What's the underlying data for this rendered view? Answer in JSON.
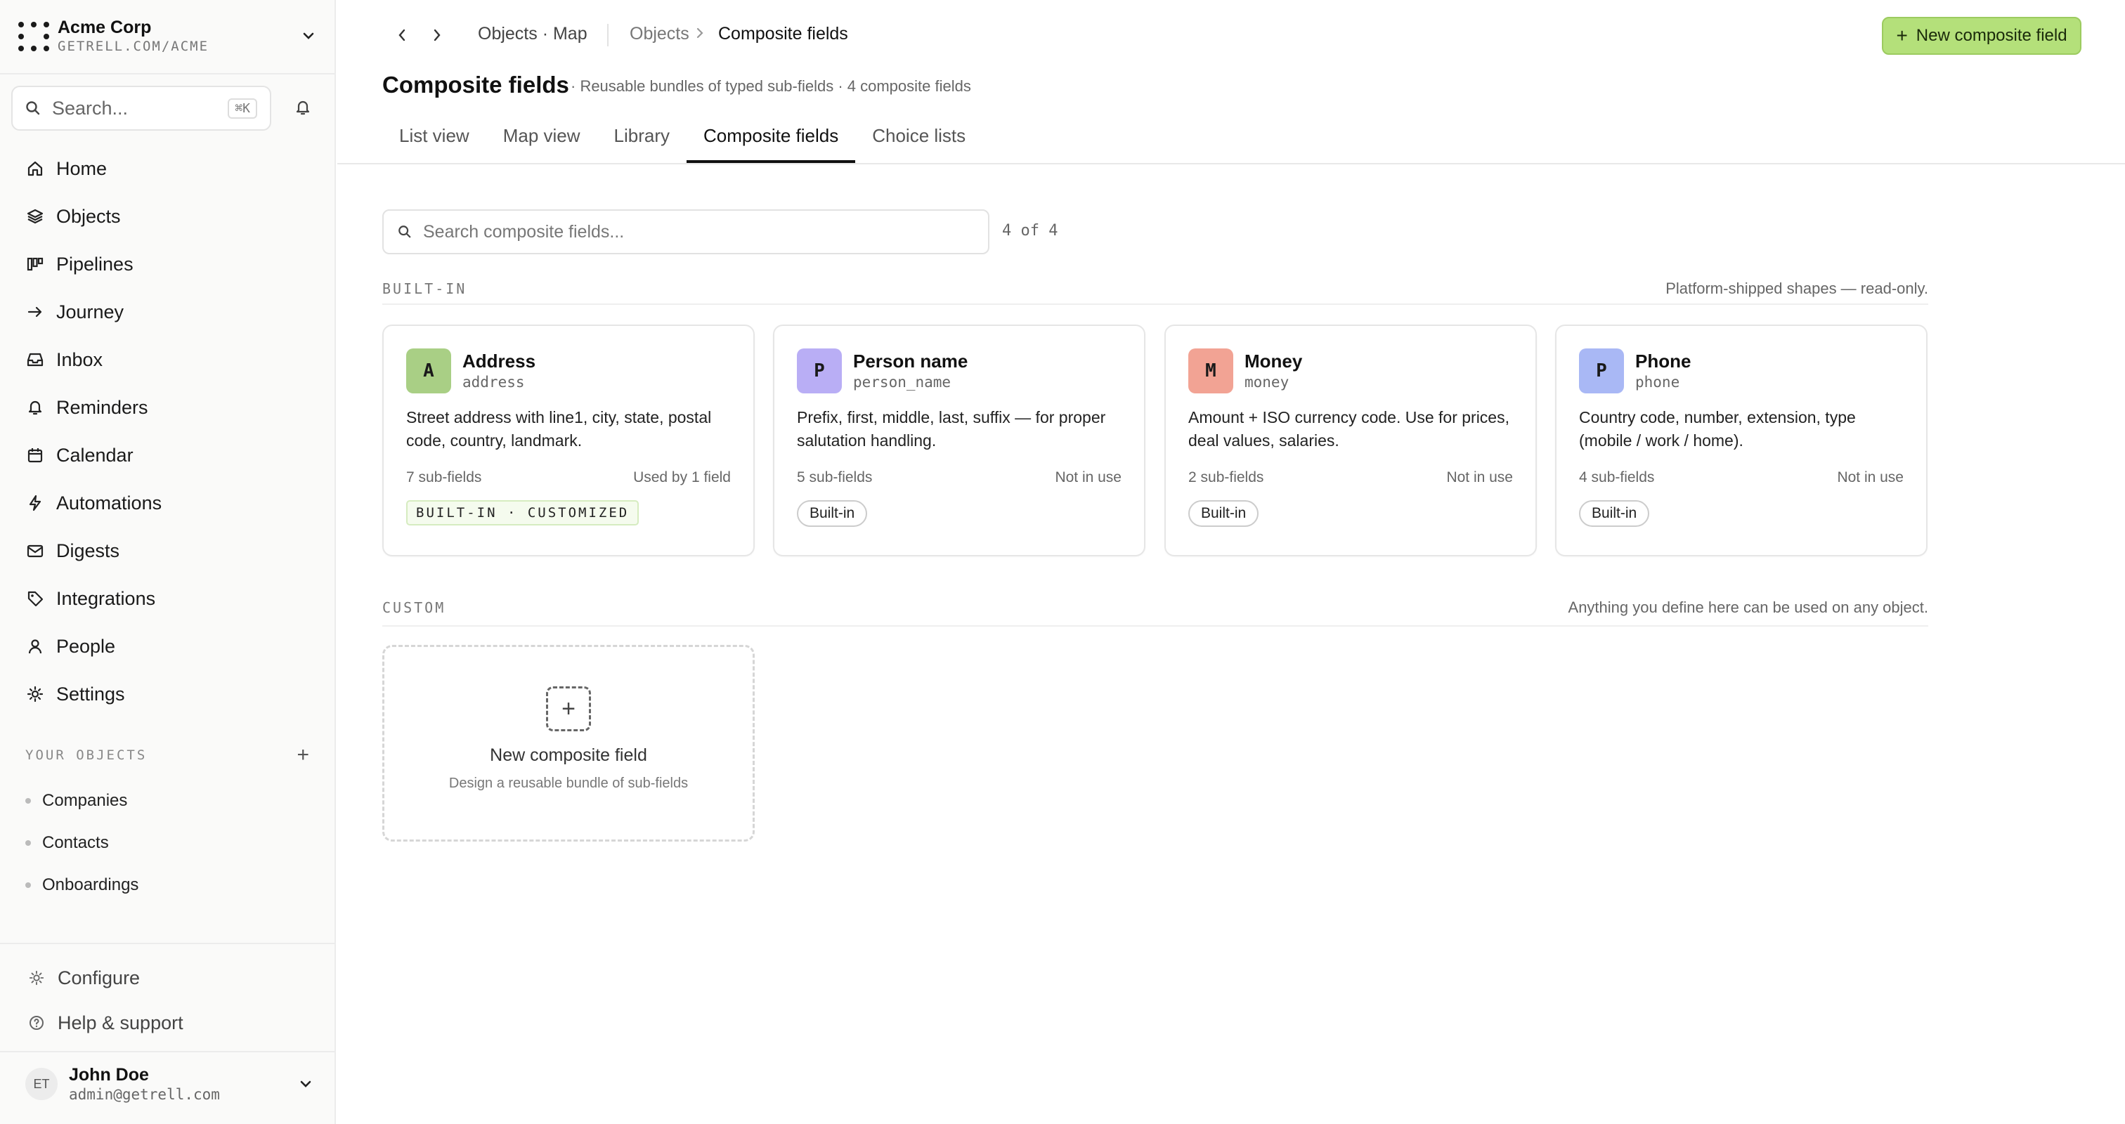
{
  "workspace": {
    "name": "Acme Corp",
    "url": "GETRELL.COM/ACME"
  },
  "search": {
    "placeholder": "Search...",
    "shortcut": "⌘K"
  },
  "nav": [
    {
      "label": "Home",
      "icon": "home-icon"
    },
    {
      "label": "Objects",
      "icon": "layers-icon"
    },
    {
      "label": "Pipelines",
      "icon": "kanban-icon"
    },
    {
      "label": "Journey",
      "icon": "arrow-right-icon"
    },
    {
      "label": "Inbox",
      "icon": "inbox-icon"
    },
    {
      "label": "Reminders",
      "icon": "bell-icon"
    },
    {
      "label": "Calendar",
      "icon": "calendar-icon"
    },
    {
      "label": "Automations",
      "icon": "bolt-icon"
    },
    {
      "label": "Digests",
      "icon": "mail-icon"
    },
    {
      "label": "Integrations",
      "icon": "tag-icon"
    },
    {
      "label": "People",
      "icon": "person-icon"
    },
    {
      "label": "Settings",
      "icon": "gear-icon"
    }
  ],
  "your_objects": {
    "title": "YOUR OBJECTS",
    "items": [
      "Companies",
      "Contacts",
      "Onboardings"
    ]
  },
  "footer": {
    "configure": "Configure",
    "help": "Help & support"
  },
  "user": {
    "initials": "ET",
    "name": "John Doe",
    "email": "admin@getrell.com"
  },
  "breadcrumb": {
    "parent": "Objects · Map",
    "section": "Objects",
    "current": "Composite fields"
  },
  "toolbar": {
    "new_label": "New composite field"
  },
  "page": {
    "title": "Composite fields",
    "subtitle": "· Reusable bundles of typed sub-fields · 4 composite fields"
  },
  "tabs": [
    "List view",
    "Map view",
    "Library",
    "Composite fields",
    "Choice lists"
  ],
  "active_tab": "Composite fields",
  "filter": {
    "placeholder": "Search composite fields...",
    "count": "4 of 4"
  },
  "builtin": {
    "title": "BUILT-IN",
    "note": "Platform-shipped shapes — read-only.",
    "cards": [
      {
        "letter": "A",
        "color": "#a9cf85",
        "name": "Address",
        "key": "address",
        "desc": "Street address with line1, city, state, postal code, country, landmark.",
        "subfields": "7 sub-fields",
        "usage": "Used by 1 field",
        "tag": "BUILT-IN · CUSTOMIZED"
      },
      {
        "letter": "P",
        "color": "#b9aef5",
        "name": "Person name",
        "key": "person_name",
        "desc": "Prefix, first, middle, last, suffix — for proper salutation handling.",
        "subfields": "5 sub-fields",
        "usage": "Not in use",
        "tag": "Built-in"
      },
      {
        "letter": "M",
        "color": "#f2a394",
        "name": "Money",
        "key": "money",
        "desc": "Amount + ISO currency code. Use for prices, deal values, salaries.",
        "subfields": "2 sub-fields",
        "usage": "Not in use",
        "tag": "Built-in"
      },
      {
        "letter": "P",
        "color": "#a9b8f5",
        "name": "Phone",
        "key": "phone",
        "desc": "Country code, number, extension, type (mobile / work / home).",
        "subfields": "4 sub-fields",
        "usage": "Not in use",
        "tag": "Built-in"
      }
    ]
  },
  "custom": {
    "title": "CUSTOM",
    "note": "Anything you define here can be used on any object.",
    "new_title": "New composite field",
    "new_sub": "Design a reusable bundle of sub-fields"
  }
}
